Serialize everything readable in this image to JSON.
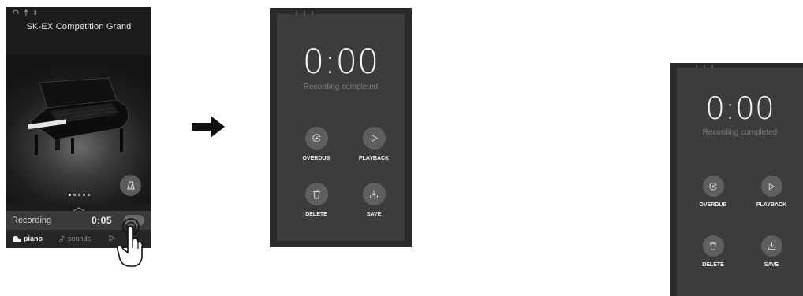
{
  "piano_screen": {
    "status_icons": [
      "headphones-icon",
      "usb-icon",
      "bluetooth-icon"
    ],
    "sound_title": "SK-EX Competition Grand",
    "page_dots": [
      true,
      false,
      false,
      false,
      false
    ],
    "recording_label": "Recording",
    "recording_time": "0:05",
    "tabs": [
      {
        "label": "piano",
        "icon": "piano-icon",
        "active": true
      },
      {
        "label": "sounds",
        "icon": "note-icon",
        "active": false
      },
      {
        "label": "",
        "icon": "play-icon",
        "active": false
      }
    ]
  },
  "arrow_icon": "right-arrow-icon",
  "recording_panel_large": {
    "time": "0:00",
    "status": "Recording completed",
    "actions": [
      {
        "label": "OVERDUB",
        "icon": "overdub-icon"
      },
      {
        "label": "PLAYBACK",
        "icon": "play-icon"
      },
      {
        "label": "DELETE",
        "icon": "trash-icon"
      },
      {
        "label": "SAVE",
        "icon": "save-icon"
      }
    ]
  },
  "recording_panel_small": {
    "time": "0:00",
    "status": "Recording completed",
    "actions": [
      {
        "label": "OVERDUB",
        "icon": "overdub-icon"
      },
      {
        "label": "PLAYBACK",
        "icon": "play-icon"
      },
      {
        "label": "DELETE",
        "icon": "trash-icon"
      },
      {
        "label": "SAVE",
        "icon": "save-icon"
      }
    ]
  },
  "colors": {
    "panel_bg": "#3c3c3c",
    "panel_frame": "#2a2a2a",
    "button_bg": "#5f5f5f",
    "text_primary": "#f4f4f4",
    "text_muted": "#7e7e7e"
  }
}
